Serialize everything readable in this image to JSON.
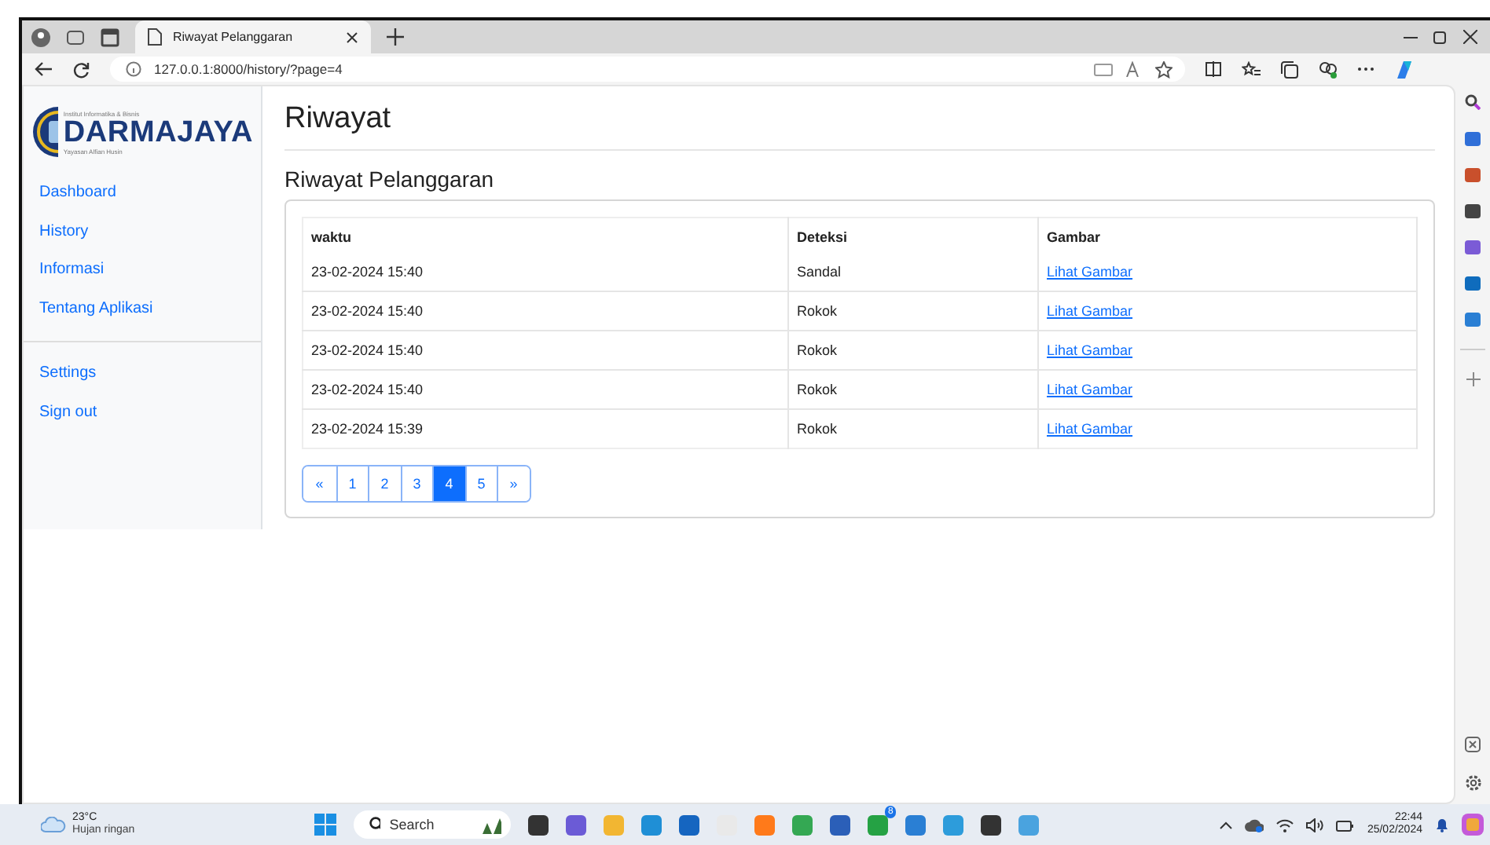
{
  "browser": {
    "tab_title": "Riwayat Pelanggaran",
    "address": "127.0.0.1:8000/history/?page=4"
  },
  "logo": {
    "top_line": "Institut Informatika & Bisnis",
    "name": "DARMAJAYA",
    "bottom_line": "Yayasan Alfian Husin"
  },
  "sidebar": {
    "items": [
      {
        "label": "Dashboard"
      },
      {
        "label": "History"
      },
      {
        "label": "Informasi"
      },
      {
        "label": "Tentang Aplikasi"
      }
    ],
    "bottom_items": [
      {
        "label": "Settings"
      },
      {
        "label": "Sign out"
      }
    ]
  },
  "page": {
    "title": "Riwayat",
    "section_title": "Riwayat Pelanggaran"
  },
  "table": {
    "columns": [
      "waktu",
      "Deteksi",
      "Gambar"
    ],
    "rows": [
      {
        "waktu": "23-02-2024 15:40",
        "deteksi": "Sandal",
        "gambar": "Lihat Gambar"
      },
      {
        "waktu": "23-02-2024 15:40",
        "deteksi": "Rokok",
        "gambar": "Lihat Gambar"
      },
      {
        "waktu": "23-02-2024 15:40",
        "deteksi": "Rokok",
        "gambar": "Lihat Gambar"
      },
      {
        "waktu": "23-02-2024 15:40",
        "deteksi": "Rokok",
        "gambar": "Lihat Gambar"
      },
      {
        "waktu": "23-02-2024 15:39",
        "deteksi": "Rokok",
        "gambar": "Lihat Gambar"
      }
    ]
  },
  "pagination": [
    {
      "label": "«",
      "selected": false
    },
    {
      "label": "1",
      "selected": false
    },
    {
      "label": "2",
      "selected": false
    },
    {
      "label": "3",
      "selected": false
    },
    {
      "label": "4",
      "selected": true
    },
    {
      "label": "5",
      "selected": false
    },
    {
      "label": "»",
      "selected": false
    }
  ],
  "taskbar": {
    "temperature": "23°C",
    "weather": "Hujan ringan",
    "search_placeholder": "Search",
    "chat_badge": "8",
    "time": "22:44",
    "date": "25/02/2024"
  }
}
